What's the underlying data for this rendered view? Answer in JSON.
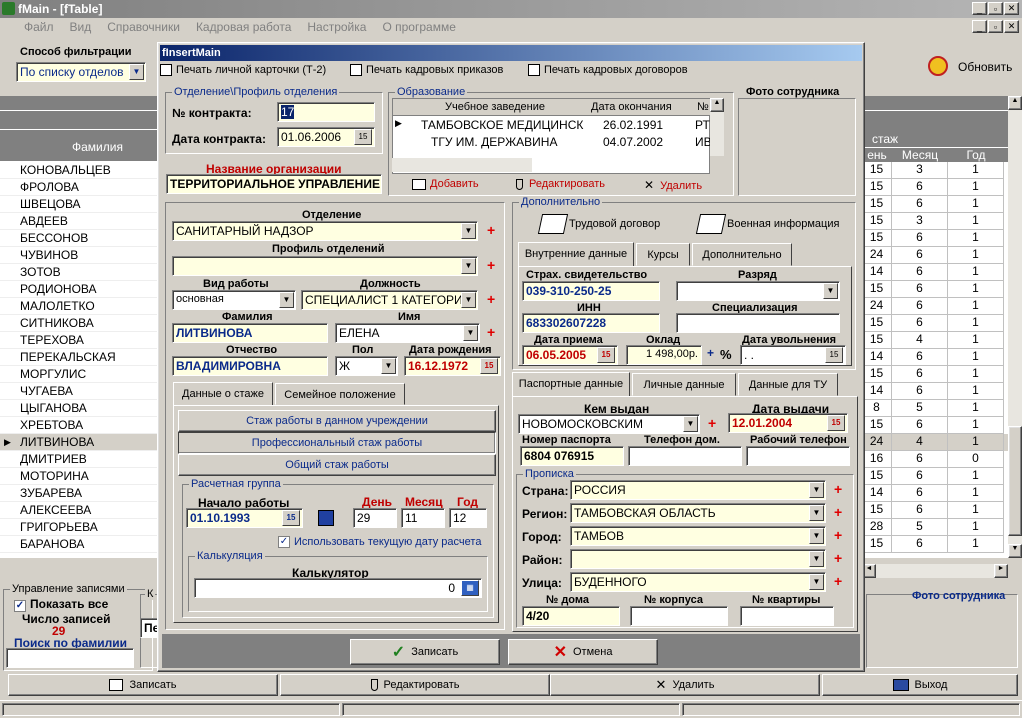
{
  "window": {
    "title": "fMain - [fTable]"
  },
  "menu": [
    "Файл",
    "Вид",
    "Справочники",
    "Кадровая работа",
    "Настройка",
    "О программе"
  ],
  "filter": {
    "label": "Способ фильтрации",
    "value": "По списку отделов"
  },
  "refresh_label": "Обновить",
  "list": {
    "header": "Фамилия",
    "rows": [
      "КОНОВАЛЬЦЕВ",
      "ФРОЛОВА",
      "ШВЕЦОВА",
      "АВДЕЕВ",
      "БЕССОНОВ",
      "ЧУВИНОВ",
      "ЗОТОВ",
      "РОДИОНОВА",
      "МАЛОЛЕТКО",
      "СИТНИКОВА",
      "ТЕРЕХОВА",
      "ПЕРЕКАЛЬСКАЯ",
      "МОРГУЛИС",
      "ЧУГАЕВА",
      "ЦЫГАНОВА",
      "ХРЕБТОВА",
      "ЛИТВИНОВА",
      "ДМИТРИЕВ",
      "МОТОРИНА",
      "ЗУБАРЕВА",
      "АЛЕКСЕЕВА",
      "ГРИГОРЬЕВА",
      "БАРАНОВА"
    ],
    "selected_index": 16
  },
  "right_grid": {
    "group_header": "стаж",
    "cols": [
      "ень",
      "Месяц",
      "Год"
    ],
    "rows": [
      [
        "15",
        "3",
        "1"
      ],
      [
        "15",
        "6",
        "1"
      ],
      [
        "15",
        "6",
        "1"
      ],
      [
        "15",
        "3",
        "1"
      ],
      [
        "15",
        "6",
        "1"
      ],
      [
        "24",
        "6",
        "1"
      ],
      [
        "14",
        "6",
        "1"
      ],
      [
        "15",
        "6",
        "1"
      ],
      [
        "24",
        "6",
        "1"
      ],
      [
        "15",
        "6",
        "1"
      ],
      [
        "15",
        "4",
        "1"
      ],
      [
        "14",
        "6",
        "1"
      ],
      [
        "15",
        "6",
        "1"
      ],
      [
        "14",
        "6",
        "1"
      ],
      [
        "8",
        "5",
        "1"
      ],
      [
        "15",
        "6",
        "1"
      ],
      [
        "24",
        "4",
        "1"
      ],
      [
        "16",
        "6",
        "0"
      ],
      [
        "15",
        "6",
        "1"
      ],
      [
        "14",
        "6",
        "1"
      ],
      [
        "15",
        "6",
        "1"
      ],
      [
        "28",
        "5",
        "1"
      ],
      [
        "15",
        "6",
        "1"
      ]
    ]
  },
  "records": {
    "title": "Управление записями",
    "show_all": "Показать все",
    "count_label": "Число записей",
    "count": "29",
    "search_label": "Поиск по фамилии",
    "photo_label": "Фото сотрудника",
    "k_label": "К",
    "p_label": "Пе"
  },
  "bottom": {
    "save": "Записать",
    "edit": "Редактировать",
    "delete": "Удалить",
    "exit": "Выход"
  },
  "dialog": {
    "title": "fInsertMain",
    "toolbar": {
      "print_card": "Печать личной карточки (Т-2)",
      "print_orders": "Печать кадровых приказов",
      "print_contracts": "Печать кадровых договоров"
    },
    "contract": {
      "group": "Отделение\\Профиль отделения",
      "num_label": "№ контракта:",
      "num": "17",
      "date_label": "Дата контракта:",
      "date": "01.06.2006"
    },
    "org": {
      "label": "Название организации",
      "value": "ТЕРРИТОРИАЛЬНОЕ УПРАВЛЕНИЕ"
    },
    "edu": {
      "group": "Образование",
      "cols": [
        "Учебное заведение",
        "Дата окончания",
        "№"
      ],
      "rows": [
        [
          "ТАМБОВСКОЕ МЕДИЦИНСК",
          "26.02.1991",
          "РТ"
        ],
        [
          "ТГУ ИМ. ДЕРЖАВИНА",
          "04.07.2002",
          "ИВ"
        ]
      ],
      "add": "Добавить",
      "edit": "Редактировать",
      "delete": "Удалить"
    },
    "photo": "Фото сотрудника",
    "dept": {
      "label": "Отделение",
      "value": "САНИТАРНЫЙ НАДЗОР"
    },
    "profile": {
      "label": "Профиль отделений",
      "value": ""
    },
    "work_type": {
      "label": "Вид работы",
      "value": "основная"
    },
    "position": {
      "label": "Должность",
      "value": "СПЕЦИАЛИСТ 1 КАТЕГОРИИ"
    },
    "surname": {
      "label": "Фамилия",
      "value": "ЛИТВИНОВА"
    },
    "name": {
      "label": "Имя",
      "value": "ЕЛЕНА"
    },
    "patronymic": {
      "label": "Отчество",
      "value": "ВЛАДИМИРОВНА"
    },
    "sex": {
      "label": "Пол",
      "value": "Ж"
    },
    "birth": {
      "label": "Дата рождения",
      "value": "16.12.1972"
    },
    "tabs_left": [
      "Данные о стаже",
      "Семейное положение"
    ],
    "stage_buttons": [
      "Стаж работы в данном учреждении",
      "Профессиональный стаж работы",
      "Общий стаж работы"
    ],
    "calc_group": {
      "title": "Расчетная группа",
      "start_label": "Начало работы",
      "start": "01.10.1993",
      "day_label": "День",
      "month_label": "Месяц",
      "year_label": "Год",
      "day": "29",
      "month": "11",
      "year": "12",
      "use_current": "Использовать текущую дату расчета"
    },
    "calc": {
      "title": "Калькуляция",
      "label": "Калькулятор",
      "value": "0"
    },
    "extra": {
      "group": "Дополнительно",
      "labor": "Трудовой договор",
      "military": "Военная информация"
    },
    "tabs_mid": [
      "Внутренние данные",
      "Курсы",
      "Дополнительно"
    ],
    "insurance": {
      "label": "Страх. свидетельство",
      "value": "039-310-250-25"
    },
    "rank": {
      "label": "Разряд",
      "value": ""
    },
    "inn": {
      "label": "ИНН",
      "value": "683302607228"
    },
    "spec": {
      "label": "Специализация",
      "value": ""
    },
    "hire": {
      "label": "Дата приема",
      "value": "06.05.2005"
    },
    "salary": {
      "label": "Оклад",
      "value": "1 498,00р.",
      "pct": "%"
    },
    "fire": {
      "label": "Дата увольнения",
      "value": " .  ."
    },
    "tabs_pass": [
      "Паспортные данные",
      "Личные данные",
      "Данные для ТУ"
    ],
    "issuer": {
      "label": "Кем выдан",
      "value": "НОВОМОСКОВСКИМ"
    },
    "issue_date": {
      "label": "Дата выдачи",
      "value": "12.01.2004"
    },
    "passport": {
      "label": "Номер паспорта",
      "value": "6804 076915"
    },
    "phone_home": {
      "label": "Телефон дом.",
      "value": ""
    },
    "phone_work": {
      "label": "Рабочий телефон",
      "value": ""
    },
    "address": {
      "group": "Прописка",
      "country_label": "Страна:",
      "country": "РОССИЯ",
      "region_label": "Регион:",
      "region": "ТАМБОВСКАЯ ОБЛАСТЬ",
      "city_label": "Город:",
      "city": "ТАМБОВ",
      "district_label": "Район:",
      "district": "",
      "street_label": "Улица:",
      "street": "БУДЕННОГО",
      "house_label": "№ дома",
      "house": "4/20",
      "corp_label": "№ корпуса",
      "corp": "",
      "flat_label": "№ квартиры",
      "flat": ""
    },
    "save": "Записать",
    "cancel": "Отмена"
  }
}
